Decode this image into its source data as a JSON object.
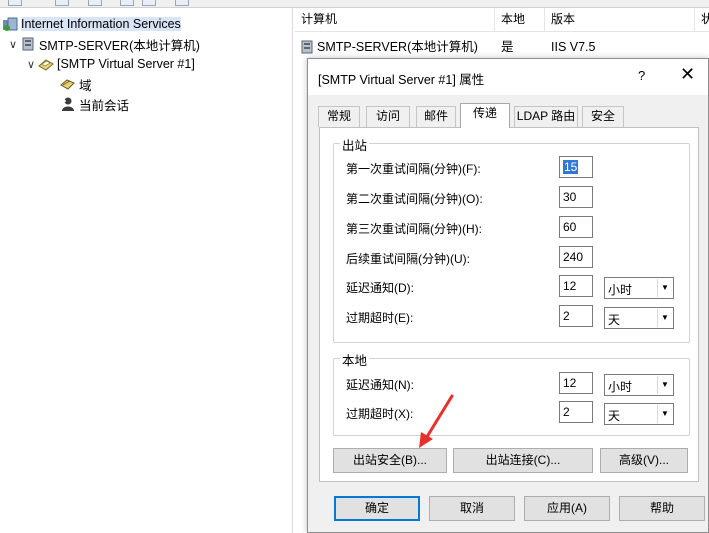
{
  "tree": {
    "root": "Internet Information Services",
    "server": "SMTP-SERVER(本地计算机)",
    "virtual_server": "[SMTP Virtual Server #1]",
    "domains": "域",
    "sessions": "当前会话"
  },
  "list": {
    "headers": [
      "计算机",
      "本地",
      "版本",
      "状"
    ],
    "row": {
      "computer": "SMTP-SERVER(本地计算机)",
      "local": "是",
      "version": "IIS V7.5"
    }
  },
  "dialog": {
    "title": "[SMTP Virtual Server #1] 属性",
    "help": "?",
    "close": "✕",
    "tabs": [
      "常规",
      "访问",
      "邮件",
      "传递",
      "LDAP 路由",
      "安全"
    ],
    "active_tab": "传递",
    "outbound": {
      "title": "出站",
      "first_retry_label": "第一次重试间隔(分钟)(F):",
      "first_retry_value": "15",
      "second_retry_label": "第二次重试间隔(分钟)(O):",
      "second_retry_value": "30",
      "third_retry_label": "第三次重试间隔(分钟)(H):",
      "third_retry_value": "60",
      "subsequent_retry_label": "后续重试间隔(分钟)(U):",
      "subsequent_retry_value": "240",
      "delay_notify_label": "延迟通知(D):",
      "delay_notify_value": "12",
      "delay_notify_unit": "小时",
      "expire_label": "过期超时(E):",
      "expire_value": "2",
      "expire_unit": "天"
    },
    "local": {
      "title": "本地",
      "delay_notify_label": "延迟通知(N):",
      "delay_notify_value": "12",
      "delay_notify_unit": "小时",
      "expire_label": "过期超时(X):",
      "expire_value": "2",
      "expire_unit": "天"
    },
    "buttons": {
      "outbound_security": "出站安全(B)...",
      "outbound_connections": "出站连接(C)...",
      "advanced": "高级(V)...",
      "ok": "确定",
      "cancel": "取消",
      "apply": "应用(A)",
      "help": "帮助"
    }
  },
  "colors": {
    "selection": "#d9e5f6",
    "annotation_arrow": "#e8302a",
    "default_button_border": "#0078d7"
  }
}
